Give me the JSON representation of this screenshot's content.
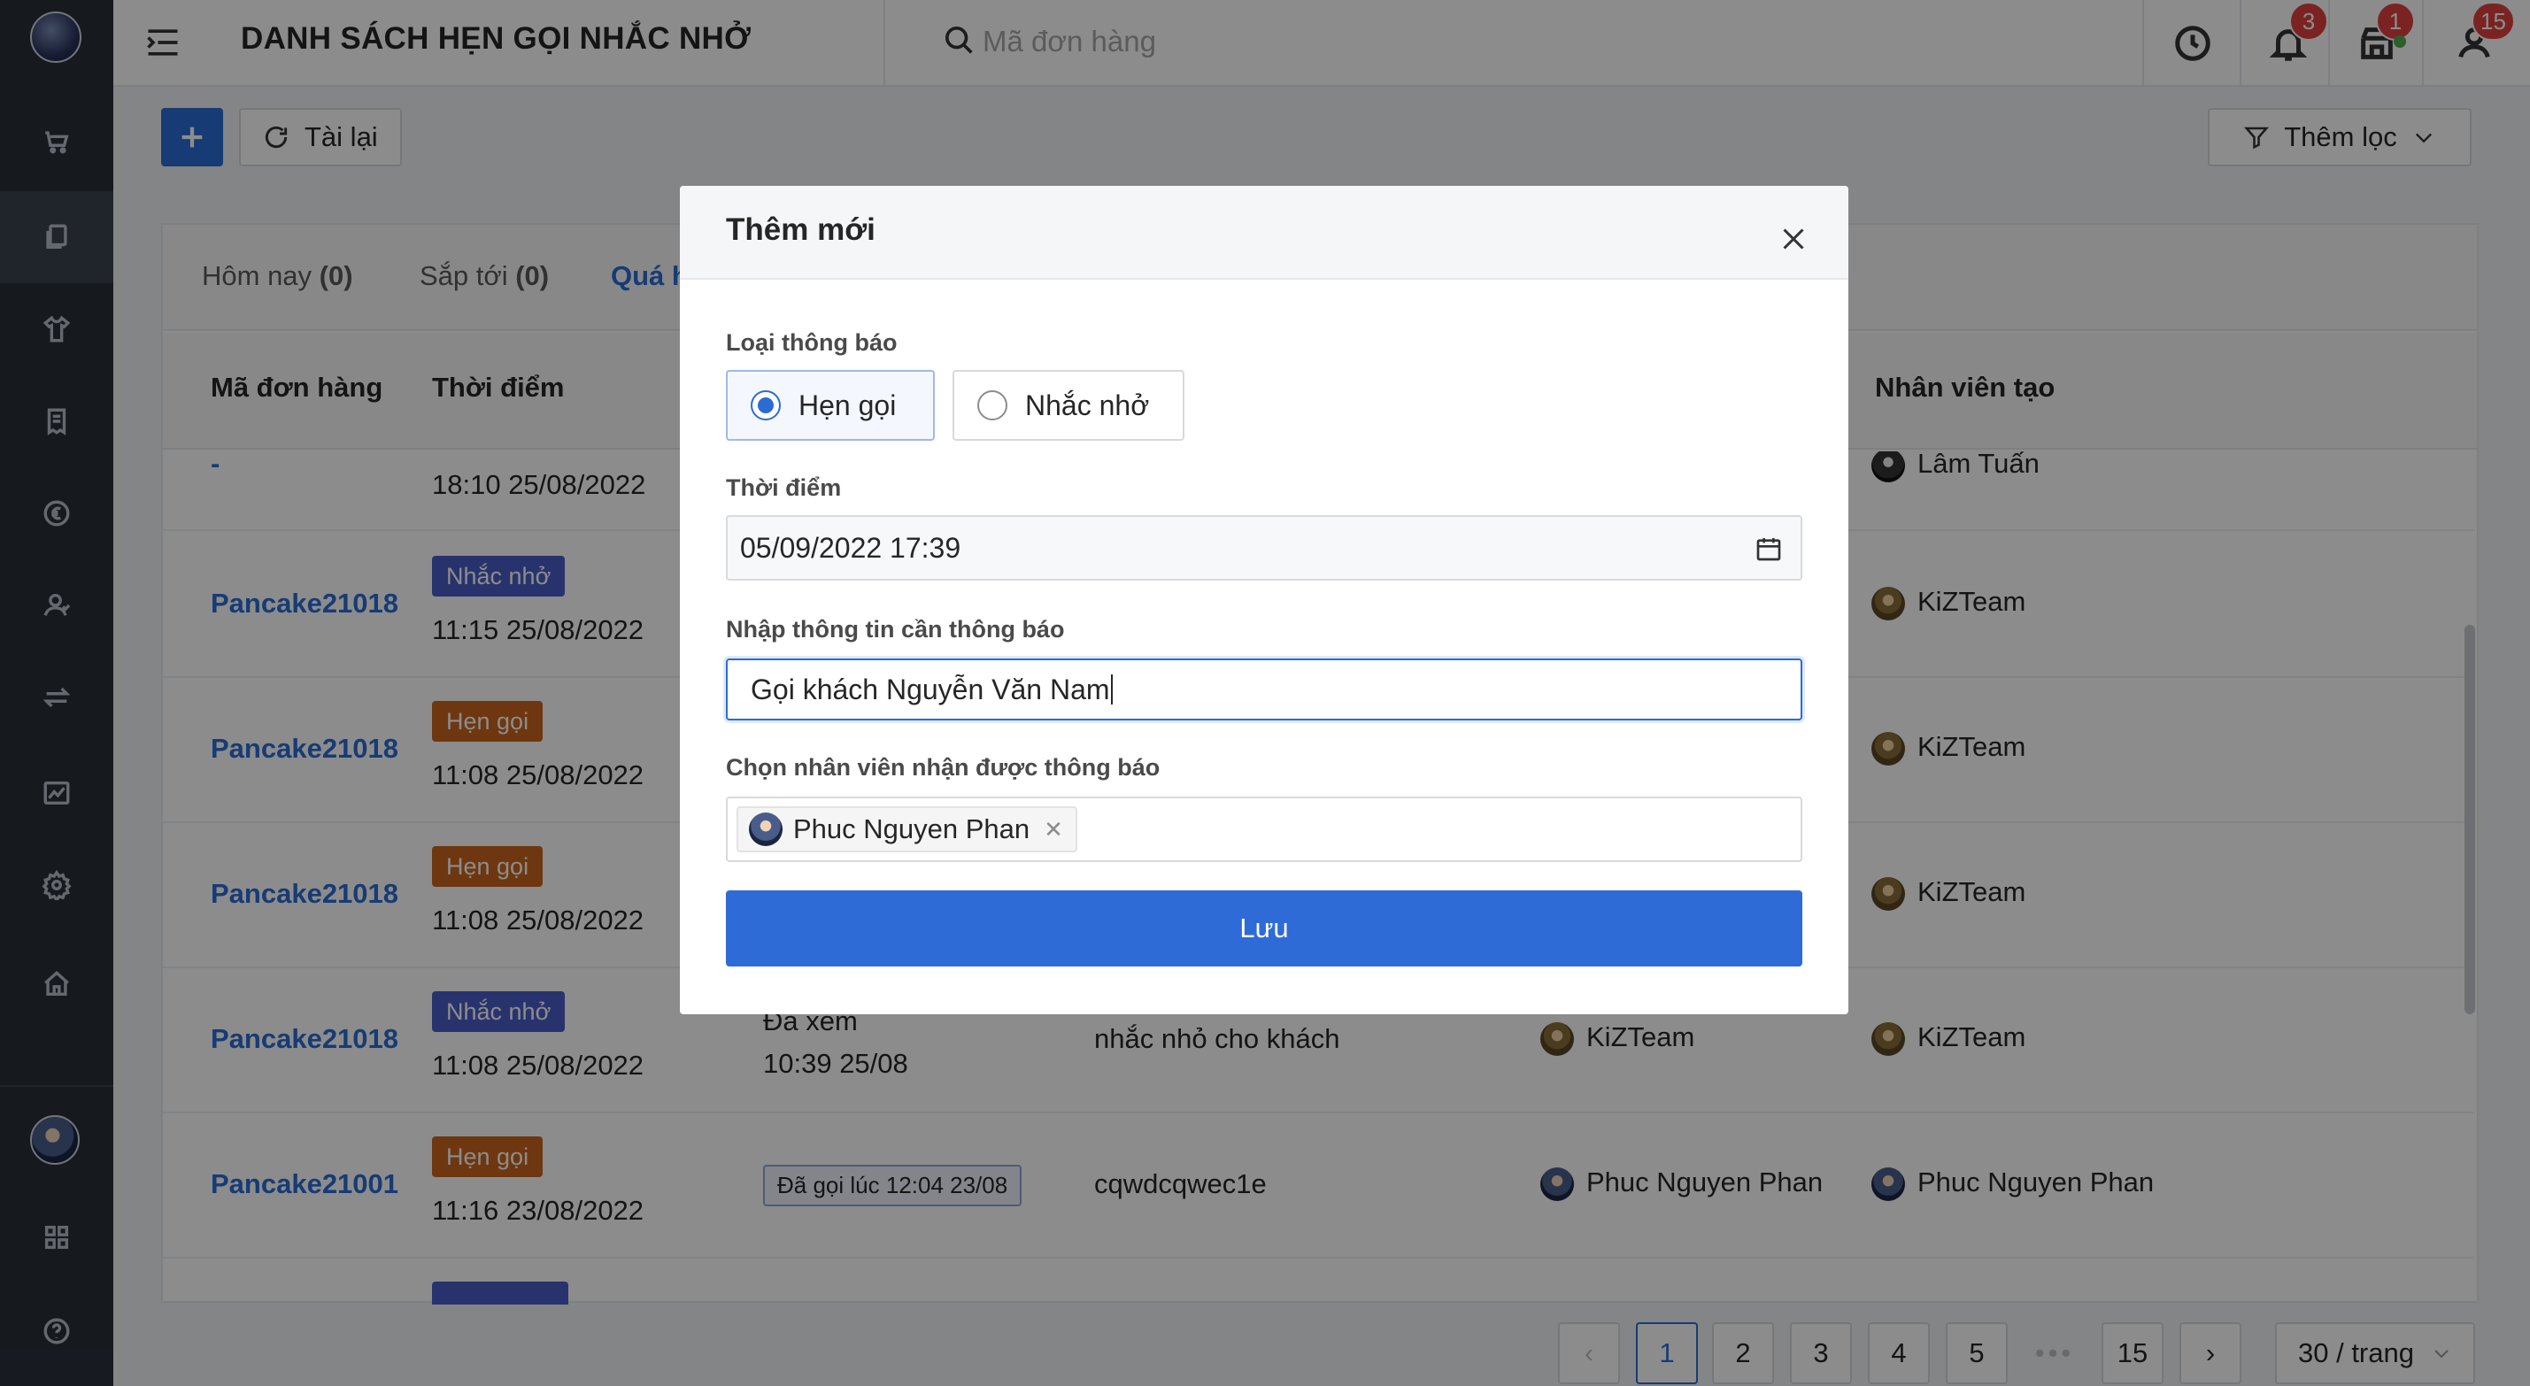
{
  "header": {
    "title": "DANH SÁCH HẸN GỌI NHẮC NHỞ",
    "search_placeholder": "Mã đơn hàng",
    "notif_badge": "3",
    "store_badge": "1",
    "user_badge": "15"
  },
  "toolbar": {
    "reload_label": "Tài lại",
    "filter_label": "Thêm lọc"
  },
  "tabs": [
    {
      "label": "Hôm nay",
      "count": "(0)"
    },
    {
      "label": "Sắp tới",
      "count": "(0)"
    },
    {
      "label": "Quá h"
    }
  ],
  "table": {
    "columns": {
      "order": "Mã đơn hàng",
      "time": "Thời điểm",
      "creator": "Nhân viên tạo"
    },
    "rows": [
      {
        "order": "-",
        "tag": "",
        "time": "18:10 25/08/2022",
        "status": "",
        "status_time": "",
        "note": "",
        "receiver": "",
        "creator": "Lâm Tuấn"
      },
      {
        "order": "Pancake21018",
        "tag": "Nhắc nhở",
        "time": "11:15 25/08/2022",
        "status": "",
        "status_time": "",
        "note": "",
        "receiver": "",
        "creator": "KiZTeam"
      },
      {
        "order": "Pancake21018",
        "tag": "Hẹn gọi",
        "time": "11:08 25/08/2022",
        "status": "",
        "status_time": "",
        "note": "",
        "receiver": "",
        "creator": "KiZTeam"
      },
      {
        "order": "Pancake21018",
        "tag": "Hẹn gọi",
        "time": "11:08 25/08/2022",
        "status": "",
        "status_time": "",
        "note": "",
        "receiver": "",
        "creator": "KiZTeam"
      },
      {
        "order": "Pancake21018",
        "tag": "Nhắc nhở",
        "time": "11:08 25/08/2022",
        "status": "Đã xem",
        "status_time": "10:39 25/08",
        "note": "nhắc nhỏ cho khách",
        "receiver": "KiZTeam",
        "creator": "KiZTeam"
      },
      {
        "order": "Pancake21001",
        "tag": "Hẹn gọi",
        "time": "11:16 23/08/2022",
        "status": "Đã gọi lúc 12:04 23/08",
        "status_time": "",
        "note": "cqwdcqwec1e",
        "receiver": "Phuc Nguyen Phan",
        "creator": "Phuc Nguyen Phan"
      }
    ]
  },
  "pagination": {
    "pages": [
      "1",
      "2",
      "3",
      "4",
      "5",
      "•••",
      "15"
    ],
    "current": "1",
    "page_size": "30 / trang"
  },
  "modal": {
    "title": "Thêm mới",
    "type_label": "Loại thông báo",
    "type_options": [
      "Hẹn gọi",
      "Nhắc nhở"
    ],
    "type_selected": "Hẹn gọi",
    "time_label": "Thời điểm",
    "time_value": "05/09/2022 17:39",
    "info_label": "Nhập thông tin cần thông báo",
    "info_value": "Gọi khách Nguyễn Văn Nam",
    "staff_label": "Chọn nhân viên nhận được thông báo",
    "staff_selected": [
      "Phuc Nguyen Phan"
    ],
    "save_label": "Lưu"
  },
  "colors": {
    "primary": "#2b6cd4",
    "sidebar": "#29303a",
    "tag_call": "#c8641e",
    "tag_remind": "#4a5ec8",
    "badge": "#e04040"
  }
}
